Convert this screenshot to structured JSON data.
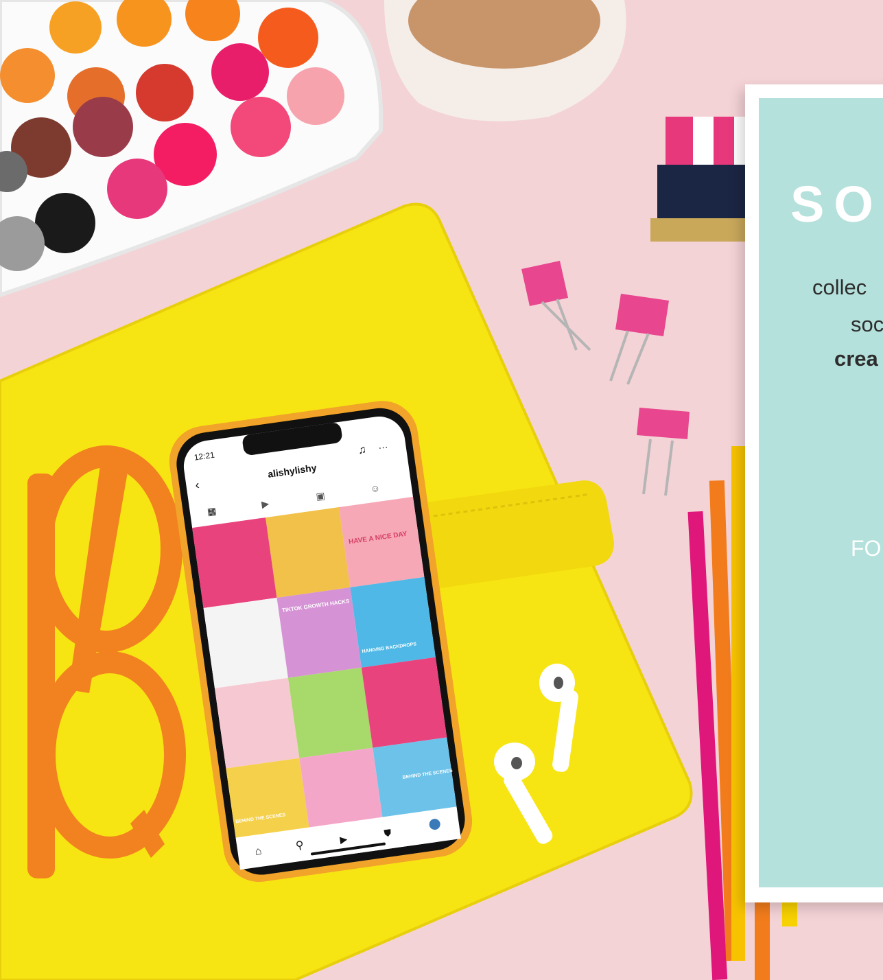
{
  "card": {
    "title": "SOC",
    "line1": "collec",
    "line2": "soc",
    "line3": "crea",
    "line4": "FO"
  },
  "phone": {
    "time": "12:21",
    "username": "alishylishy",
    "tiles": [
      "HAVE A NICE DAY",
      "TIKTOK GROWTH HACKS",
      "HANGING BACKDROPS",
      "BEHIND THE SCENES",
      "BEHIND THE SCENES"
    ]
  },
  "colors": {
    "background": "#f4d3d6",
    "card_bg": "#b5e1dc",
    "planner_yellow": "#f7e413",
    "glasses_orange": "#f2811f",
    "clip_pink": "#e8468e"
  },
  "icons": [
    "back-icon",
    "bell-icon",
    "more-icon",
    "grid-icon",
    "reels-icon",
    "tv-icon",
    "tagged-icon",
    "home-icon",
    "search-icon",
    "shop-icon"
  ]
}
